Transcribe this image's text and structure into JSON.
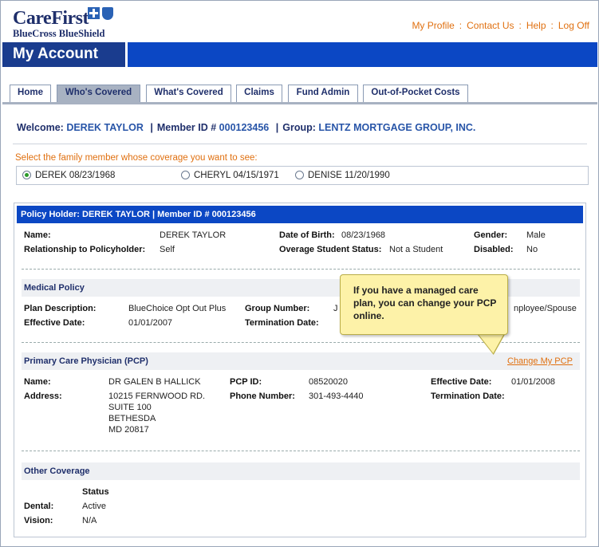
{
  "brand": {
    "name_line1": "CareFirst",
    "name_line2": "BlueCross BlueShield"
  },
  "top_links": [
    "My Profile",
    "Contact Us",
    "Help",
    "Log Off"
  ],
  "page_title": "My Account",
  "tabs": [
    {
      "label": "Home",
      "active": false
    },
    {
      "label": "Who's Covered",
      "active": true
    },
    {
      "label": "What's Covered",
      "active": false
    },
    {
      "label": "Claims",
      "active": false
    },
    {
      "label": "Fund Admin",
      "active": false
    },
    {
      "label": "Out-of-Pocket Costs",
      "active": false
    }
  ],
  "welcome": {
    "welcome_label": "Welcome:",
    "name": "DEREK TAYLOR",
    "member_label": "Member ID #",
    "member_id": "000123456",
    "group_label": "Group:",
    "group": "LENTZ MORTGAGE GROUP, INC."
  },
  "family": {
    "prompt": "Select the family member whose coverage you want to see:",
    "members": [
      {
        "label": "DEREK 08/23/1968",
        "selected": true
      },
      {
        "label": "CHERYL 04/15/1971",
        "selected": false
      },
      {
        "label": "DENISE 11/20/1990",
        "selected": false
      }
    ]
  },
  "policy": {
    "header": "Policy Holder: DEREK TAYLOR  | Member ID # 000123456",
    "name_label": "Name:",
    "name": "DEREK TAYLOR",
    "dob_label": "Date of Birth:",
    "dob": "08/23/1968",
    "gender_label": "Gender:",
    "gender": "Male",
    "relationship_label": "Relationship to Policyholder:",
    "relationship": "Self",
    "overage_label": "Overage Student Status:",
    "overage": "Not a Student",
    "disabled_label": "Disabled:",
    "disabled": "No"
  },
  "medical": {
    "section_title": "Medical Policy",
    "plan_label": "Plan Description:",
    "plan": "BlueChoice Opt Out Plus",
    "group_number_label": "Group Number:",
    "group_number_visible": "J",
    "coverage_visible": "nployee/Spouse",
    "effective_label": "Effective Date:",
    "effective": "01/01/2007",
    "termination_label": "Termination Date:"
  },
  "pcp": {
    "section_title": "Primary Care Physician (PCP)",
    "change_link": "Change My PCP",
    "name_label": "Name:",
    "name": "DR GALEN B HALLICK",
    "pcp_id_label": "PCP ID:",
    "pcp_id": "08520020",
    "effective_label": "Effective Date:",
    "effective": "01/01/2008",
    "address_label": "Address:",
    "address": [
      "10215 FERNWOOD RD.",
      "SUITE 100",
      "BETHESDA",
      "MD  20817"
    ],
    "phone_label": "Phone Number:",
    "phone": "301-493-4440",
    "termination_label": "Termination Date:"
  },
  "other": {
    "section_title": "Other Coverage",
    "status_header": "Status",
    "rows": [
      {
        "label": "Dental:",
        "status": "Active"
      },
      {
        "label": "Vision:",
        "status": "N/A"
      }
    ]
  },
  "tooltip": {
    "text": "If you have a managed care plan, you can change your PCP online."
  }
}
